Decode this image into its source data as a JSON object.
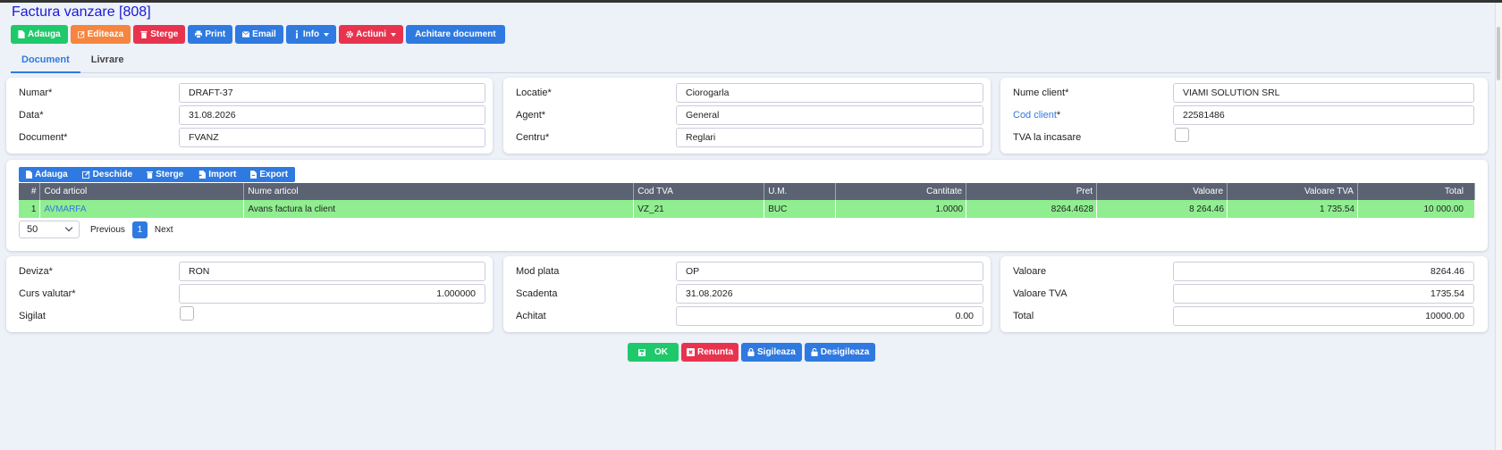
{
  "page": {
    "title": "Factura vanzare [808]"
  },
  "toolbar": {
    "add": "Adauga",
    "edit": "Editeaza",
    "delete": "Sterge",
    "print": "Print",
    "email": "Email",
    "info": "Info",
    "actions": "Actiuni",
    "settle": "Achitare document"
  },
  "tabs": {
    "document": "Document",
    "delivery": "Livrare"
  },
  "header": {
    "numar": {
      "label": "Numar*",
      "value": "DRAFT-37"
    },
    "data": {
      "label": "Data*",
      "value": "31.08.2026"
    },
    "document": {
      "label": "Document*",
      "value": "FVANZ"
    },
    "locatie": {
      "label": "Locatie*",
      "value": "Ciorogarla"
    },
    "agent": {
      "label": "Agent*",
      "value": "General"
    },
    "centru": {
      "label": "Centru*",
      "value": "Reglari"
    },
    "client": {
      "label": "Nume client*",
      "value": "VIAMI SOLUTION SRL"
    },
    "cod_client": {
      "link": "Cod client",
      "star": "*",
      "value": "22581486"
    },
    "tva_incasare": {
      "label": "TVA la incasare"
    }
  },
  "items_toolbar": {
    "add": "Adauga",
    "open": "Deschide",
    "delete": "Sterge",
    "import": "Import",
    "export": "Export"
  },
  "items_table": {
    "columns": [
      "#",
      "Cod articol",
      "Nume articol",
      "Cod TVA",
      "U.M.",
      "Cantitate",
      "Pret",
      "Valoare",
      "Valoare TVA",
      "Total"
    ],
    "rows": [
      [
        "1",
        "AVMARFA",
        "Avans factura la client",
        "VZ_21",
        "BUC",
        "1.0000",
        "8264.4628",
        "8 264.46",
        "1 735.54",
        "10 000.00"
      ]
    ]
  },
  "pager": {
    "page_size": "50",
    "previous": "Previous",
    "page": "1",
    "next": "Next"
  },
  "footer": {
    "deviza": {
      "label": "Deviza*",
      "value": "RON"
    },
    "curs": {
      "label": "Curs valutar*",
      "value": "1.000000"
    },
    "sigilat": {
      "label": "Sigilat"
    },
    "mod_plata": {
      "label": "Mod plata",
      "value": "OP"
    },
    "scadenta": {
      "label": "Scadenta",
      "value": "31.08.2026"
    },
    "achitat": {
      "label": "Achitat",
      "value": "0.00"
    },
    "valoare": {
      "label": "Valoare",
      "value": "8264.46"
    },
    "valoare_tva": {
      "label": "Valoare TVA",
      "value": "1735.54"
    },
    "total": {
      "label": "Total",
      "value": "10000.00"
    }
  },
  "actions": {
    "ok": "OK",
    "cancel": "Renunta",
    "seal": "Sigileaza",
    "unseal": "Desigileaza"
  },
  "colors": {
    "green": "#1fc96b",
    "orange": "#f5853f",
    "red": "#e8334f",
    "blue": "#2f7ae0",
    "row_green": "#90ee90",
    "header_dark": "#5b6272",
    "title_blue": "#1a1ad6"
  }
}
